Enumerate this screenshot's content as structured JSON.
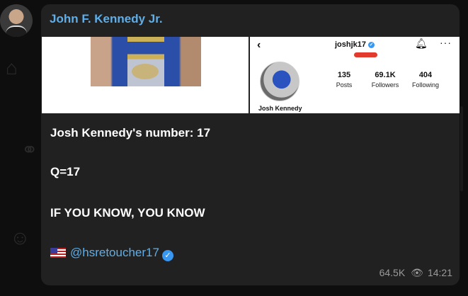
{
  "message": {
    "sender": "John F. Kennedy Jr.",
    "lines": [
      "Josh Kennedy's number: 17",
      "Q=17",
      "IF YOU KNOW, YOU KNOW"
    ],
    "channel_handle": "@hsretoucher17",
    "flag_icon": "us-flag-icon",
    "views": "64.5K",
    "time": "14:21"
  },
  "instagram": {
    "username": "joshjk17",
    "display_name": "Josh Kennedy",
    "stats": [
      {
        "value": "135",
        "label": "Posts"
      },
      {
        "value": "69.1K",
        "label": "Followers"
      },
      {
        "value": "404",
        "label": "Following"
      }
    ]
  },
  "colors": {
    "accent": "#5eaee9",
    "bubble": "#212121",
    "background": "#0e0e0e"
  }
}
